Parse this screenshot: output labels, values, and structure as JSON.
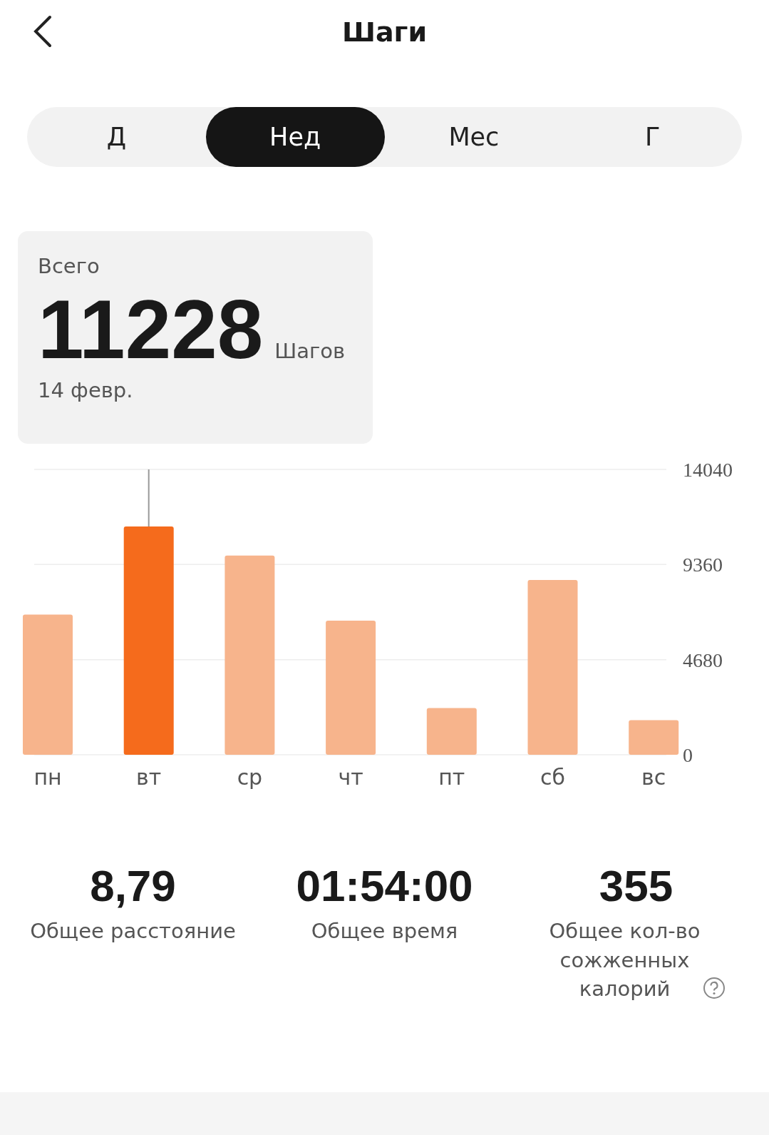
{
  "header": {
    "title": "Шаги"
  },
  "tabs": [
    {
      "label": "Д",
      "selected": false
    },
    {
      "label": "Нед",
      "selected": true
    },
    {
      "label": "Мес",
      "selected": false
    },
    {
      "label": "Г",
      "selected": false
    }
  ],
  "summary": {
    "label": "Всего",
    "value": "11228",
    "unit": "Шагов",
    "date": "14 февр."
  },
  "chart": {
    "chart_data": {
      "type": "bar",
      "categories": [
        "пн",
        "вт",
        "ср",
        "чт",
        "пт",
        "сб",
        "вс"
      ],
      "series": [
        {
          "color": "#f7b48c",
          "values": [
            6900,
            null,
            9800,
            6600,
            2300,
            8600,
            1700
          ]
        },
        {
          "color": "#f56b1c",
          "values": [
            null,
            11228,
            null,
            null,
            null,
            null,
            null
          ]
        }
      ],
      "stacked": true,
      "ylim": [
        0,
        14040
      ],
      "yticks": [
        0,
        4680,
        9360,
        14040
      ]
    }
  },
  "stats": [
    {
      "value": "8,79",
      "label": "Общее расстояние",
      "help": false
    },
    {
      "value": "01:54:00",
      "label": "Общее время",
      "help": false
    },
    {
      "value": "355",
      "label": "Общее кол-во сожженных калорий",
      "help": true
    }
  ]
}
